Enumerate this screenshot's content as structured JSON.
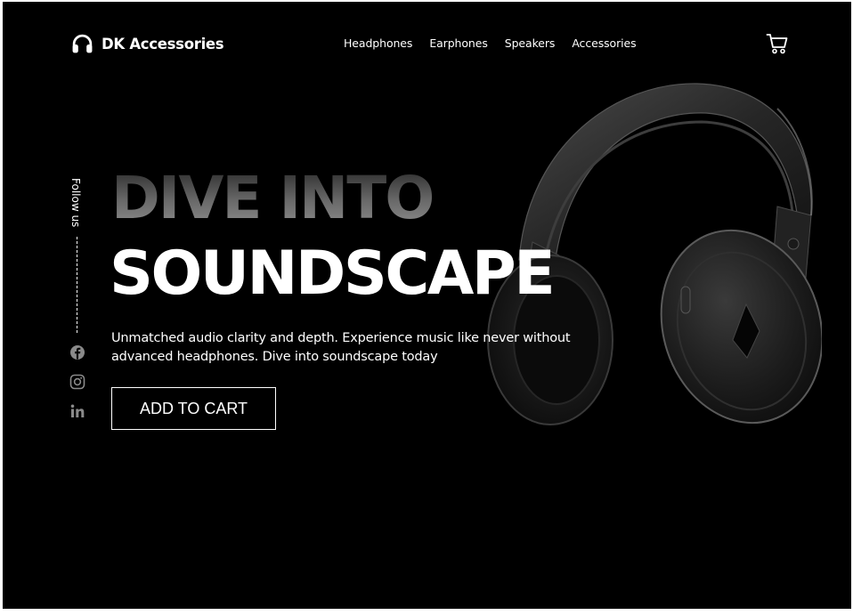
{
  "brand": {
    "name": "DK Accessories",
    "icon": "headphones-icon"
  },
  "nav": {
    "items": [
      {
        "label": "Headphones"
      },
      {
        "label": "Earphones"
      },
      {
        "label": "Speakers"
      },
      {
        "label": "Accessories"
      }
    ]
  },
  "header": {
    "cart_icon": "cart-icon"
  },
  "hero": {
    "headline_line1": "DIVE INTO",
    "headline_line2": "SOUNDSCAPE",
    "description": "Unmatched audio clarity and depth. Experience music like never without advanced headphones. Dive into soundscape today",
    "cta_label": "ADD TO CART",
    "image": "over-ear-headphones-photo"
  },
  "social": {
    "label": "Follow us",
    "icons": [
      "facebook-icon",
      "instagram-icon",
      "linkedin-icon"
    ]
  },
  "colors": {
    "background": "#000000",
    "text": "#ffffff",
    "muted_icon": "#8a8a8a"
  }
}
